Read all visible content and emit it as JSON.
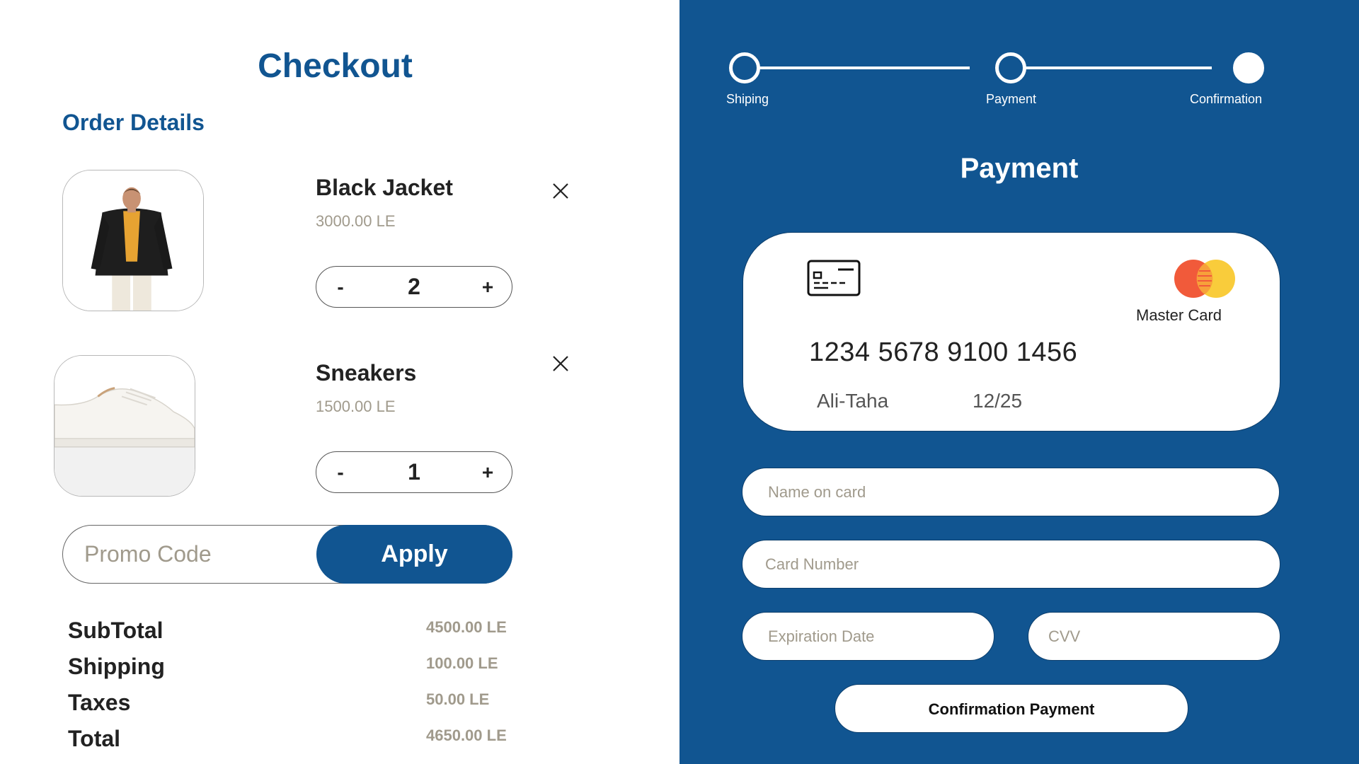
{
  "checkout": {
    "title": "Checkout",
    "order_details_heading": "Order Details",
    "items": [
      {
        "name": "Black Jacket",
        "price": "3000.00 LE",
        "quantity": "2",
        "minus": "-",
        "plus": "+"
      },
      {
        "name": "Sneakers",
        "price": "1500.00 LE",
        "quantity": "1",
        "minus": "-",
        "plus": "+"
      }
    ],
    "promo": {
      "placeholder": "Promo Code",
      "apply_label": "Apply"
    },
    "summary": [
      {
        "label": "SubTotal",
        "value": "4500.00 LE"
      },
      {
        "label": "Shipping",
        "value": "100.00 LE"
      },
      {
        "label": "Taxes",
        "value": "50.00 LE"
      },
      {
        "label": "Total",
        "value": "4650.00 LE"
      }
    ]
  },
  "payment": {
    "steps": [
      {
        "label": "Shiping",
        "state": "done"
      },
      {
        "label": "Payment",
        "state": "done"
      },
      {
        "label": "Confirmation",
        "state": "current"
      }
    ],
    "title": "Payment",
    "card": {
      "icon": "credit-card-icon",
      "brand_logo": "mastercard-logo",
      "brand": "Master Card",
      "number": "1234 5678 9100 1456",
      "holder": "Ali-Taha",
      "expiry": "12/25"
    },
    "fields": {
      "name_placeholder": "Name on card",
      "number_placeholder": "Card Number",
      "expiry_placeholder": "Expiration Date",
      "cvv_placeholder": "CVV"
    },
    "confirm_label": "Confirmation Payment"
  },
  "colors": {
    "primary": "#115591",
    "muted_text": "#a09a8c",
    "white": "#ffffff"
  }
}
